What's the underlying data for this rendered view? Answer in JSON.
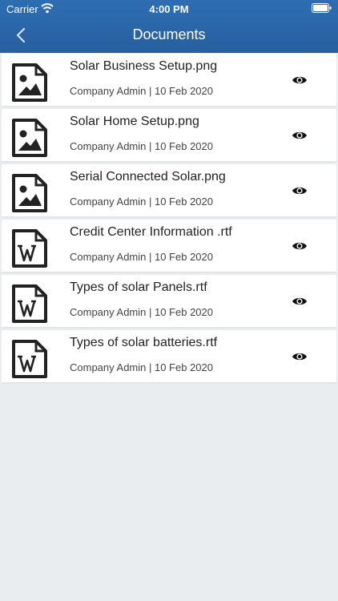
{
  "status_bar": {
    "carrier": "Carrier",
    "time": "4:00 PM"
  },
  "header": {
    "title": "Documents"
  },
  "documents": [
    {
      "name": "Solar Business Setup.png",
      "meta": "Company Admin | 10 Feb 2020",
      "icon": "image-file-icon"
    },
    {
      "name": "Solar Home Setup.png",
      "meta": "Company Admin | 10 Feb 2020",
      "icon": "image-file-icon"
    },
    {
      "name": "Serial Connected Solar.png",
      "meta": "Company Admin | 10 Feb 2020",
      "icon": "image-file-icon"
    },
    {
      "name": "Credit Center Information .rtf",
      "meta": "Company Admin | 10 Feb 2020",
      "icon": "word-file-icon"
    },
    {
      "name": "Types of solar Panels.rtf",
      "meta": "Company Admin | 10 Feb 2020",
      "icon": "word-file-icon"
    },
    {
      "name": "Types of solar batteries.rtf",
      "meta": "Company Admin | 10 Feb 2020",
      "icon": "word-file-icon"
    }
  ],
  "colors": {
    "header": "#2f6db3",
    "background": "#e9edf0"
  }
}
